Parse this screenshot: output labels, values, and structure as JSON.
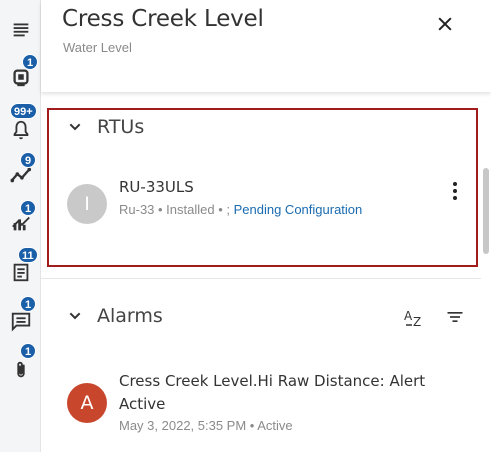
{
  "rail": {
    "items": [
      {
        "icon": "devices-icon",
        "badge": "1"
      },
      {
        "icon": "bell-icon",
        "badge": "99+"
      },
      {
        "icon": "trend-icon",
        "badge": "9"
      },
      {
        "icon": "chart-icon",
        "badge": "1"
      },
      {
        "icon": "document-icon",
        "badge": "11"
      },
      {
        "icon": "comment-icon",
        "badge": "1"
      },
      {
        "icon": "paperclip-icon",
        "badge": "1"
      }
    ]
  },
  "header": {
    "title": "Cress Creek Level",
    "subtitle": "Water Level"
  },
  "rtus": {
    "title": "RTUs",
    "item": {
      "avatar_letter": "I",
      "name": "RU-33ULS",
      "sub_text": "Ru-33 • Installed • ; ",
      "link_text": "Pending Configuration"
    }
  },
  "alarms": {
    "title": "Alarms",
    "item": {
      "avatar_letter": "A",
      "title": "Cress Creek Level.Hi Raw Distance: Alert Active",
      "sub_text": "May 3, 2022, 5:35 PM • Active"
    }
  },
  "colors": {
    "accent": "#1a5fa8",
    "highlight_border": "#a31c1c",
    "rtu_avatar": "#c9c9c9",
    "alarm_avatar": "#c8472c"
  }
}
